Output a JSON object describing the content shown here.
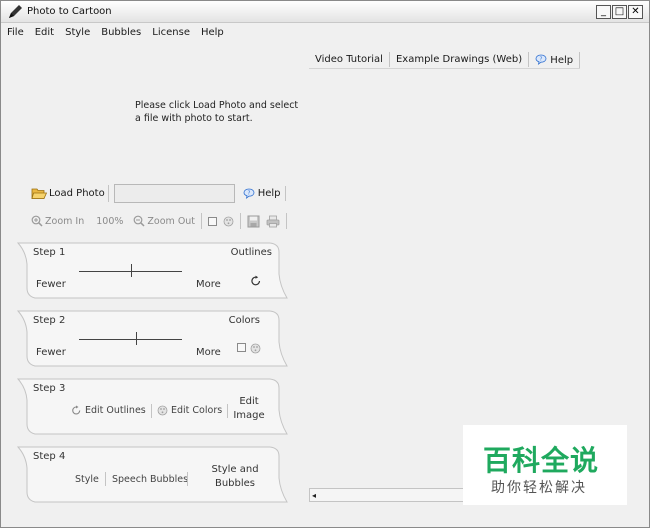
{
  "window": {
    "title": "Photo to Cartoon",
    "minimize_label": "_",
    "maximize_label": "□",
    "close_label": "✕"
  },
  "menu": [
    "File",
    "Edit",
    "Style",
    "Bubbles",
    "License",
    "Help"
  ],
  "right_tabs": {
    "video": "Video Tutorial",
    "examples": "Example Drawings (Web)",
    "help": "Help"
  },
  "instruction": "Please click Load Photo and select a file with photo to start.",
  "load": {
    "button": "Load Photo",
    "field_value": "",
    "help": "Help"
  },
  "zoom": {
    "zoom_in": "Zoom In",
    "level": "100%",
    "zoom_out": "Zoom Out"
  },
  "steps": {
    "step1": {
      "title": "Step 1",
      "right": "Outlines",
      "min": "Fewer",
      "max": "More",
      "slider_value": 0.5
    },
    "step2": {
      "title": "Step 2",
      "right": "Colors",
      "min": "Fewer",
      "max": "More",
      "slider_value": 0.55
    },
    "step3": {
      "title": "Step 3",
      "edit_outlines": "Edit Outlines",
      "edit_colors": "Edit Colors",
      "edit_image_1": "Edit",
      "edit_image_2": "Image"
    },
    "step4": {
      "title": "Step 4",
      "style": "Style",
      "speech": "Speech Bubbles",
      "sb_1": "Style and",
      "sb_2": "Bubbles"
    }
  },
  "watermark": {
    "main": "百科全说",
    "sub": "助你轻松解决"
  },
  "colors": {
    "watermark_green": "#1fa95e",
    "help_blue": "#2f6fd0"
  }
}
